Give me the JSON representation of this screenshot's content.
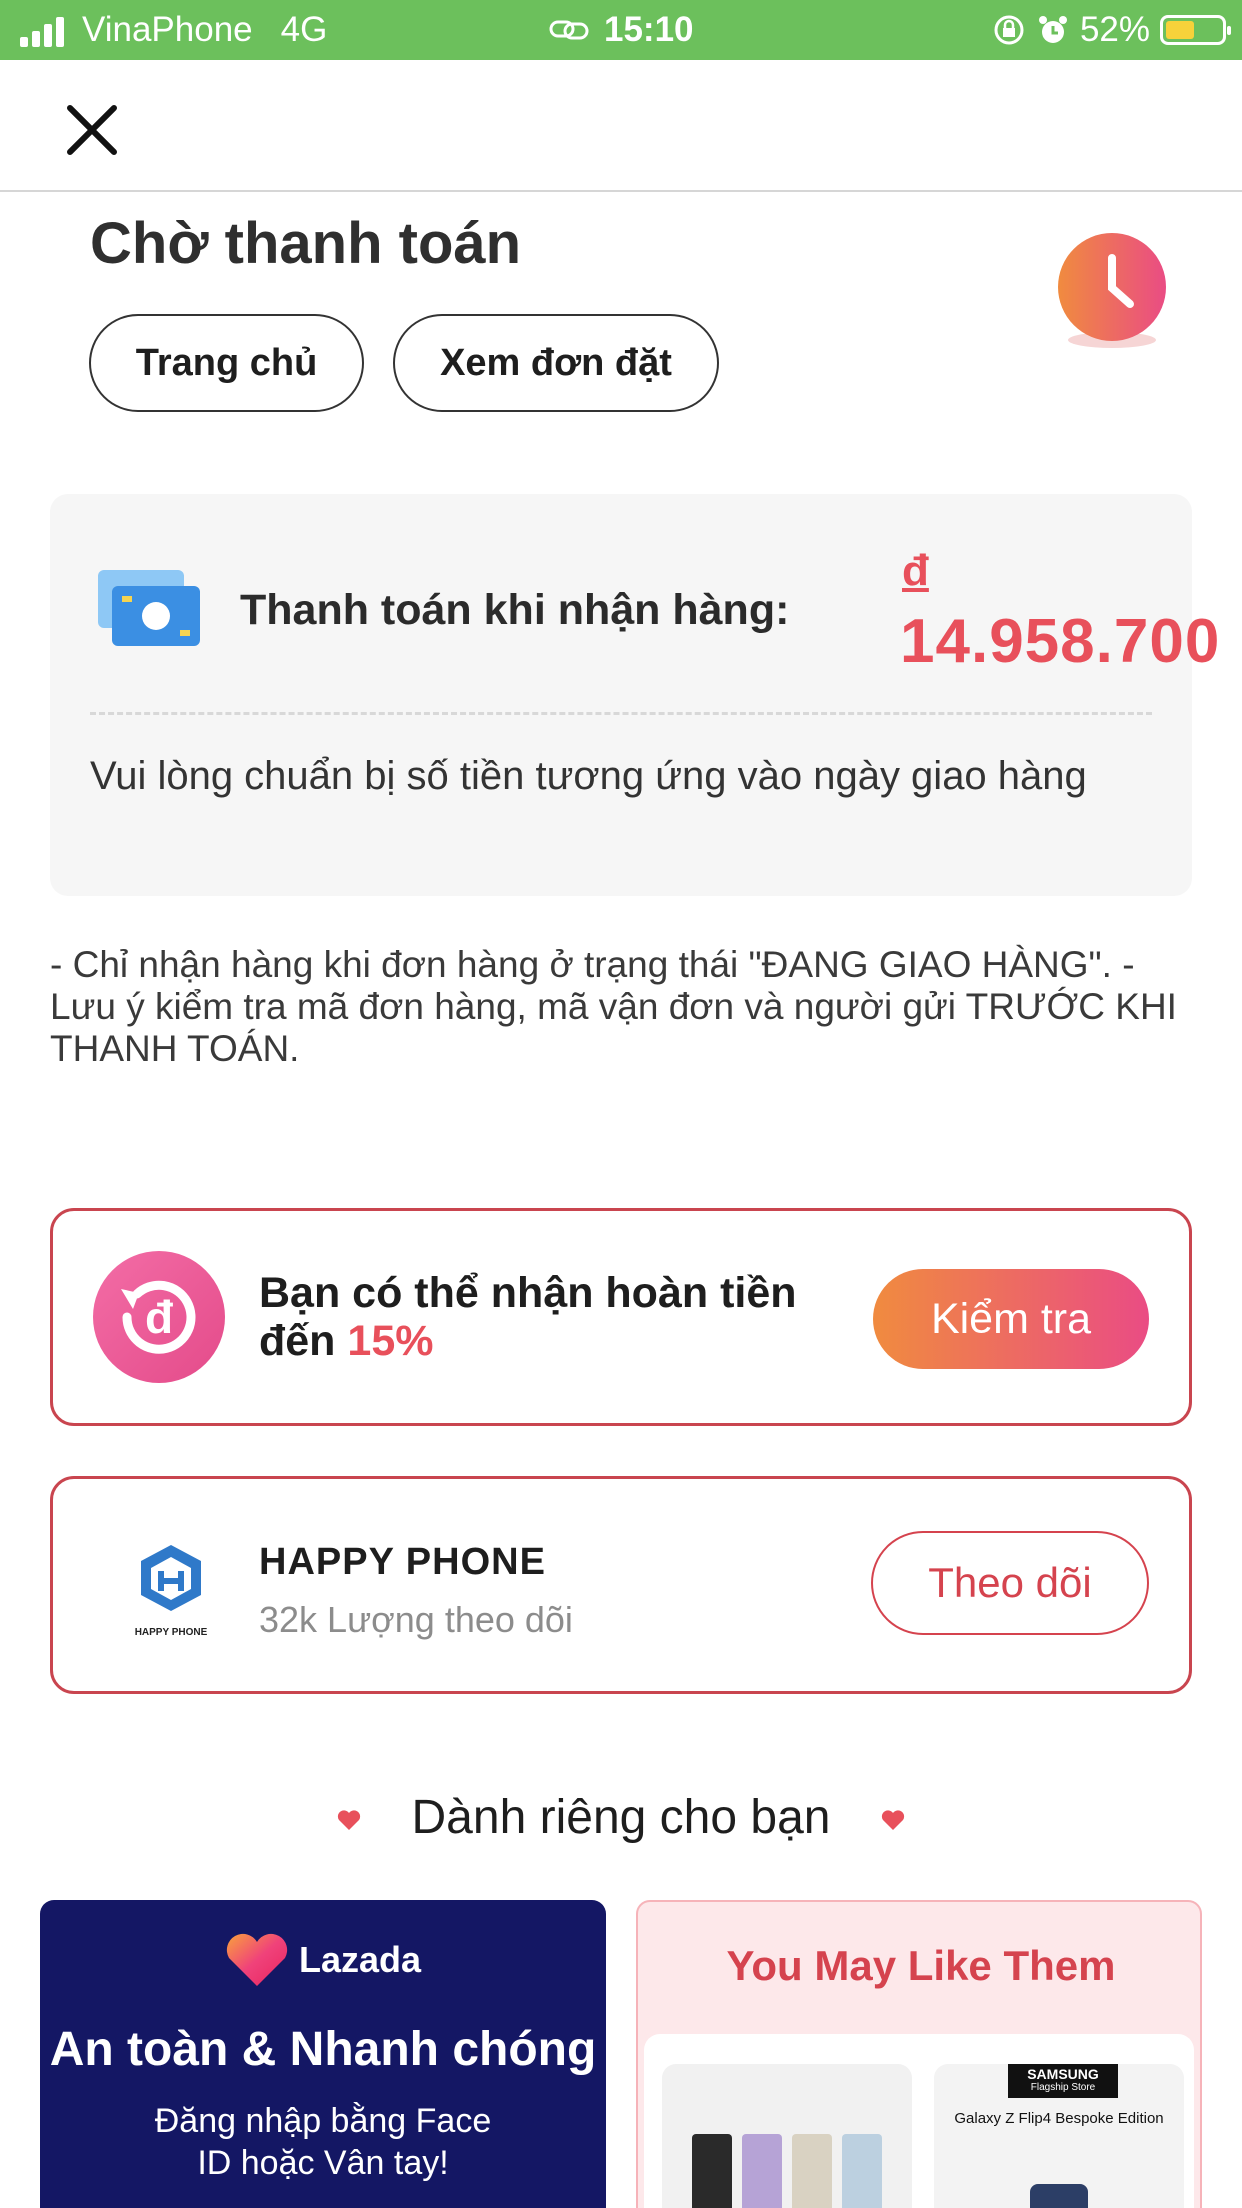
{
  "status_bar": {
    "carrier": "VinaPhone",
    "network": "4G",
    "time": "15:10",
    "battery_percent": "52%",
    "battery_level": 0.52,
    "icons": [
      "signal-icon",
      "link-icon",
      "rotation-lock-icon",
      "alarm-icon",
      "battery-icon"
    ]
  },
  "header": {
    "close_icon": "close-icon"
  },
  "page": {
    "title": "Chờ thanh toán",
    "buttons": {
      "home": "Trang chủ",
      "orders": "Xem đơn đặt"
    },
    "status_icon": "clock-icon"
  },
  "payment": {
    "label": "Thanh toán khi nhận hàng:",
    "currency": "đ",
    "amount": "14.958.700",
    "note": "Vui lòng chuẩn bị số tiền tương ứng vào ngày giao hàng",
    "icon": "cash-icon"
  },
  "notice": "- Chỉ nhận hàng khi đơn hàng ở trạng thái \"ĐANG GIAO HÀNG\". - Lưu ý kiểm tra mã đơn hàng, mã vận đơn và người gửi TRƯỚC KHI THANH TOÁN.",
  "refund": {
    "text": "Bạn có thể nhận hoàn tiền đến",
    "percent": "15%",
    "button": "Kiểm tra",
    "icon": "refund-icon"
  },
  "shop": {
    "name": "HAPPY PHONE",
    "logo_text": "HAPPY PHONE",
    "followers": "32k Lượng theo dõi",
    "button": "Theo dõi"
  },
  "recommend": {
    "title": "Dành riêng cho bạn",
    "lazada_banner": {
      "brand": "Lazada",
      "headline": "An toàn & Nhanh chóng",
      "sub1": "Đăng nhập bằng Face",
      "sub2": "ID hoặc Vân tay!"
    },
    "like_banner": {
      "title": "You May Like Them",
      "badge_brand": "SAMSUNG",
      "badge_sub": "Flagship Store",
      "product_title": "Galaxy Z Flip4 Bespoke Edition"
    }
  },
  "colors": {
    "status_bar": "#6cc05c",
    "accent_red": "#e8505b",
    "card_border": "#c9454f",
    "gradient_start": "#f08b3f",
    "gradient_end": "#ea4c84",
    "lazada_bg": "#141764"
  }
}
